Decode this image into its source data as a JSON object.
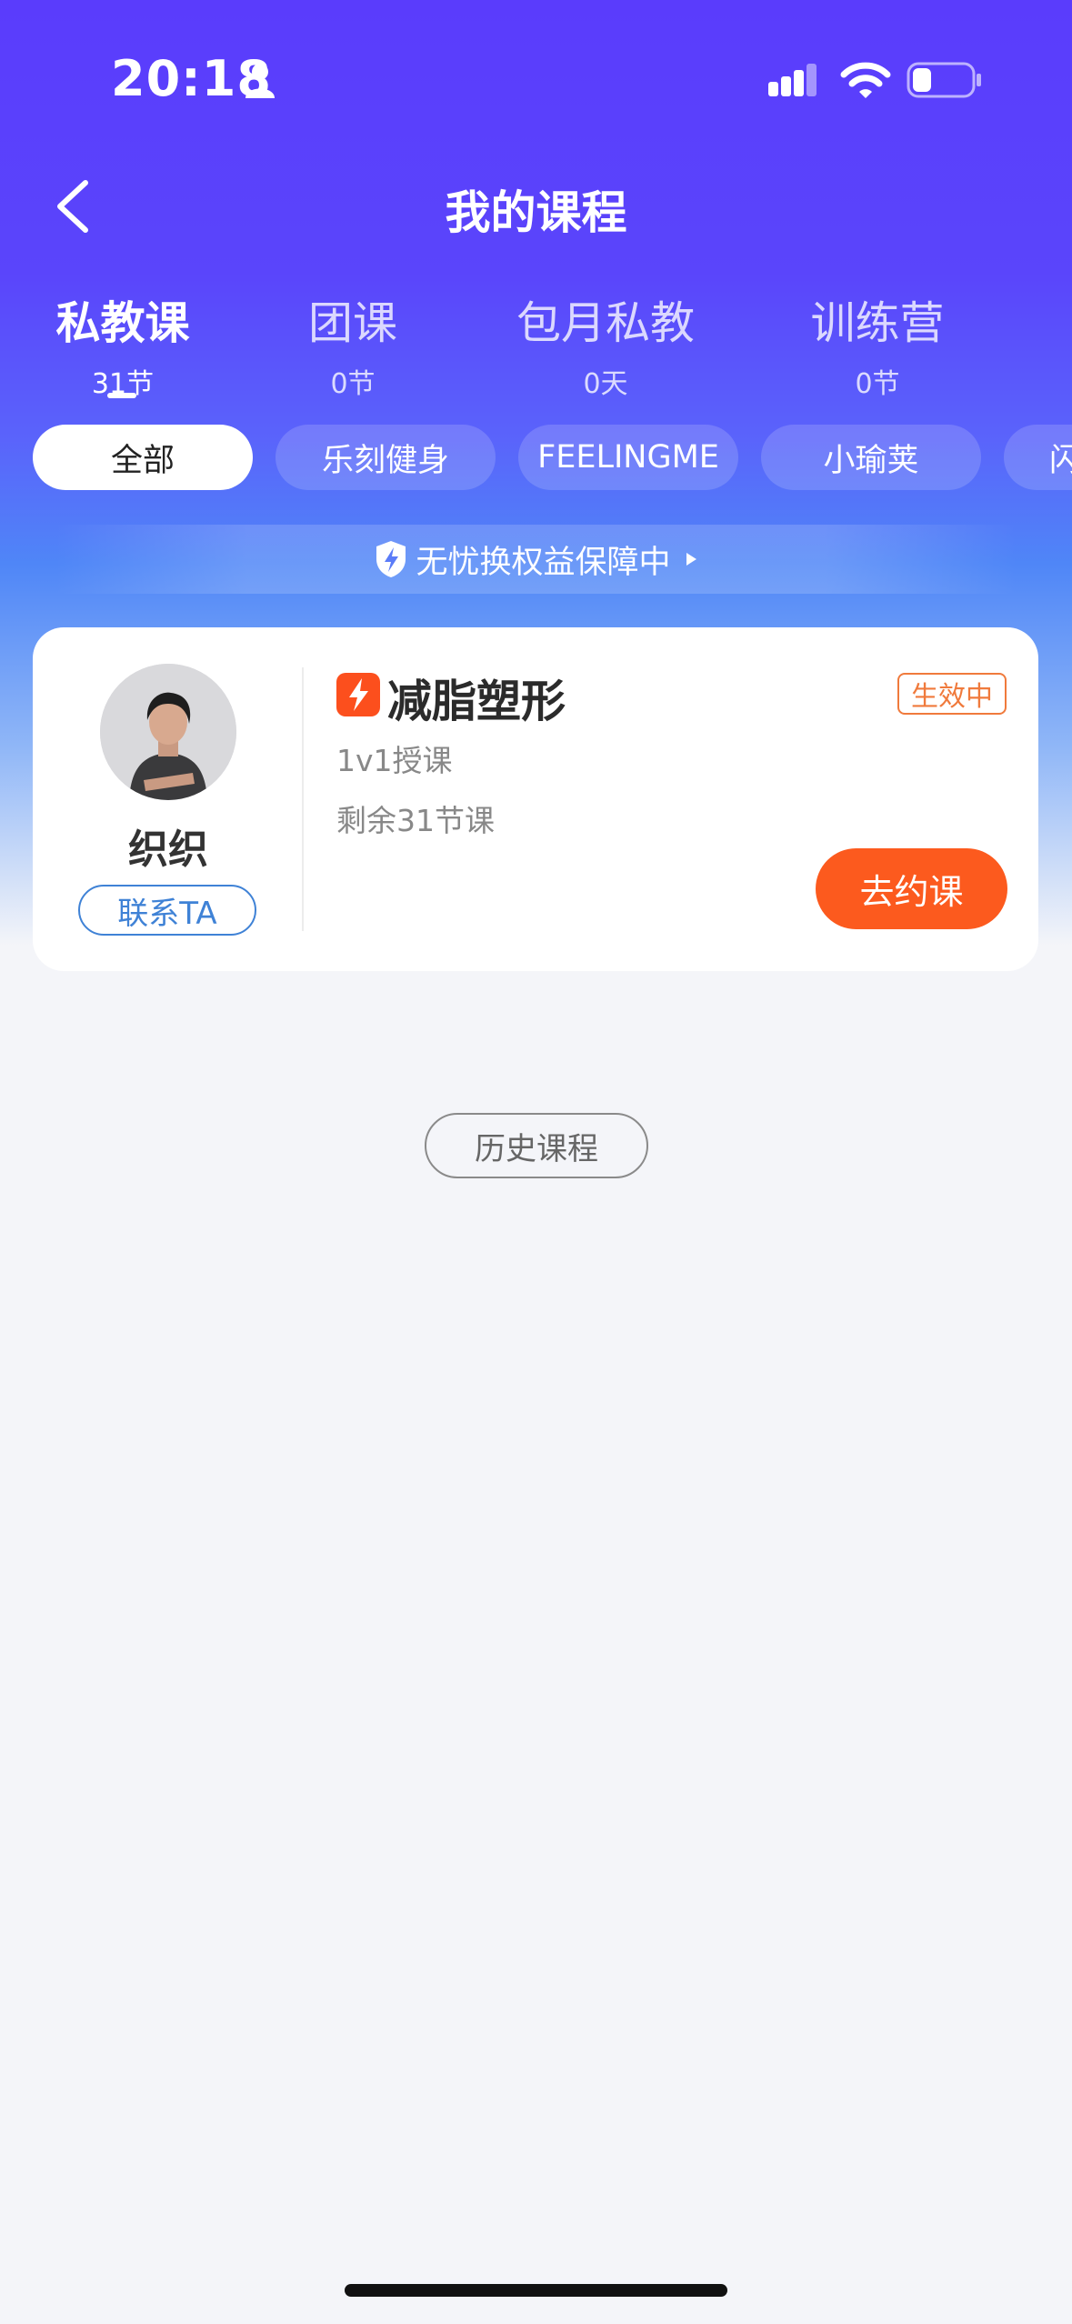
{
  "status_bar": {
    "time": "20:18"
  },
  "header": {
    "title": "我的课程"
  },
  "tabs": [
    {
      "label": "私教课",
      "count": "31节",
      "active": true
    },
    {
      "label": "团课",
      "count": "0节"
    },
    {
      "label": "包月私教",
      "count": "0天"
    },
    {
      "label": "训练营",
      "count": "0节"
    }
  ],
  "filters": [
    "全部",
    "乐刻健身",
    "FEELINGME",
    "小瑜荚",
    "闪"
  ],
  "banner": {
    "text": "无忧换权益保障中"
  },
  "course_card": {
    "coach_name": "织织",
    "contact_label": "联系TA",
    "title": "减脂塑形",
    "status": "生效中",
    "type": "1v1授课",
    "remaining": "剩余31节课",
    "book_label": "去约课"
  },
  "history_label": "历史课程",
  "colors": {
    "primary": "#5a3cfc",
    "accent": "#fc5a1e",
    "link": "#3f82d6"
  }
}
